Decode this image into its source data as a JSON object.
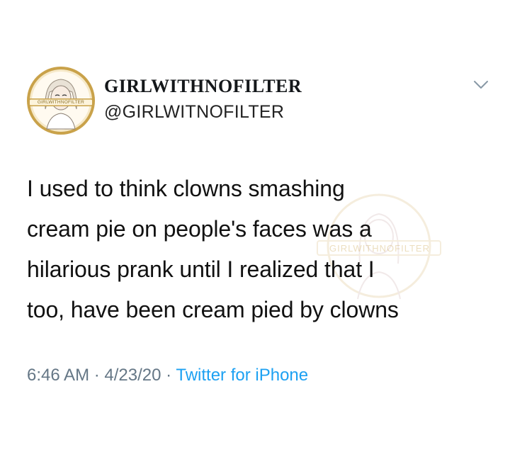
{
  "tweet": {
    "display_name": "GIRLWITHNOFILTER",
    "handle": "@GIRLWITNOFILTER",
    "avatar_badge_text": "GIRLWITHNOFILTER",
    "body_lines": [
      "I used to think clowns smashing",
      "cream pie on people's faces was a",
      "hilarious prank until I realized that I",
      "too, have been cream pied by clowns"
    ],
    "watermark_text": "GIRLWITHNOFILTER",
    "time": "6:46 AM",
    "separator": " · ",
    "date": "4/23/20",
    "source": "Twitter for iPhone",
    "icons": {
      "avatar": "avatar-icon",
      "more": "chevron-down-icon",
      "watermark": "watermark-logo-icon"
    },
    "colors": {
      "link": "#1da1f2",
      "meta": "#657786",
      "text": "#14171a",
      "gold": "#c9a24a"
    }
  }
}
